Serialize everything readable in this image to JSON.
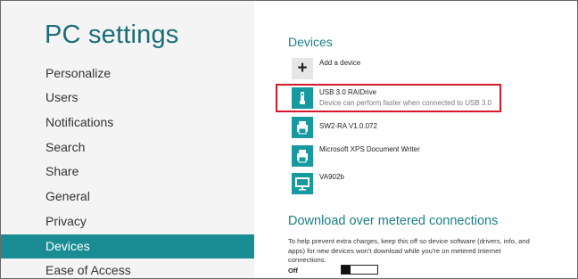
{
  "app": {
    "title": "PC settings"
  },
  "sidebar": {
    "items": [
      {
        "label": "Personalize",
        "selected": false
      },
      {
        "label": "Users",
        "selected": false
      },
      {
        "label": "Notifications",
        "selected": false
      },
      {
        "label": "Search",
        "selected": false
      },
      {
        "label": "Share",
        "selected": false
      },
      {
        "label": "General",
        "selected": false
      },
      {
        "label": "Privacy",
        "selected": false
      },
      {
        "label": "Devices",
        "selected": true
      },
      {
        "label": "Ease of Access",
        "selected": false
      }
    ]
  },
  "devices": {
    "title": "Devices",
    "add_label": "Add a device",
    "list": [
      {
        "name": "USB 3.0 RAIDrive",
        "description": "Device can perform faster when connected to USB 3.0",
        "icon": "usb-drive-icon"
      },
      {
        "name": "SW2-RA V1.0.072",
        "icon": "printer-icon"
      },
      {
        "name": "Microsoft XPS Document Writer",
        "icon": "printer-icon"
      },
      {
        "name": "VA902b",
        "icon": "monitor-icon"
      }
    ]
  },
  "metered": {
    "title": "Download over metered connections",
    "description": "To help prevent extra charges, keep this off so device software (drivers, info, and apps) for new devices won't download while you're on metered Internet connections.",
    "toggle_label": "Off",
    "toggle_on": false
  },
  "colors": {
    "accent": "#1a8c94",
    "title": "#1a6e76",
    "highlight": "#d6192c",
    "icon_tile": "#169aa0"
  }
}
